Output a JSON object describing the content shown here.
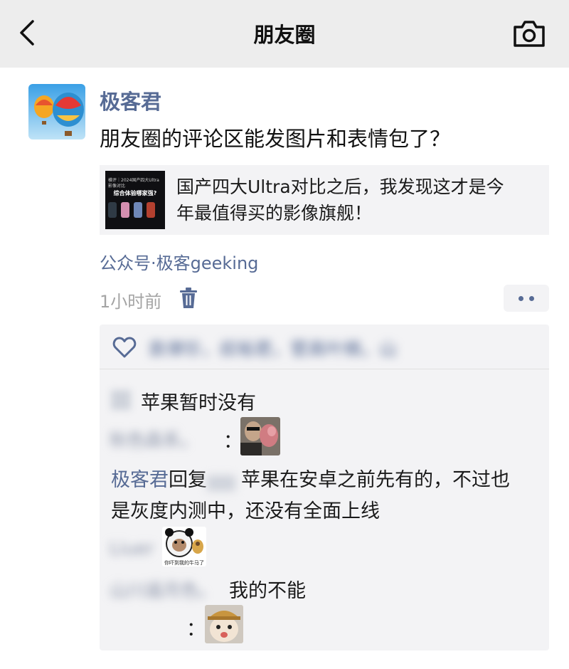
{
  "nav": {
    "title": "朋友圈",
    "back_icon": "chevron-left-icon",
    "camera_icon": "camera-icon"
  },
  "post": {
    "author": "极客君",
    "text": "朋友圈的评论区能发图片和表情包了？",
    "share": {
      "thumb_caption": "横评｜2024国产四大Ultra影像对比",
      "thumb_title": "综合体验哪家强?",
      "title_line1": "国产四大Ultra对比之后，我发现这才是今",
      "title_line2": "年最值得买的影像旗舰！"
    },
    "source": "公众号·极客geeking",
    "time": "1小时前",
    "delete_icon": "trash-icon",
    "more_icon": "more-dots-icon"
  },
  "likes": {
    "icon": "heart-icon",
    "names": "袁律珍，叔裕君，菅高叶楠，山"
  },
  "comments": [
    {
      "name": "",
      "text": "苹果暂时没有"
    },
    {
      "name": "秋色森系。",
      "sep": "：",
      "sticker": "sticker-meme-man"
    },
    {
      "name": "极客君",
      "reply_word": "回复",
      "reply_to": "",
      "text_line1": "苹果在安卓之前先有的，不过也",
      "text_line2": "是灰度内测中，还没有全面上线"
    },
    {
      "name": "Liuer",
      "sticker": "sticker-panda-meme",
      "sticker_caption": "你吓到我的牛马了"
    },
    {
      "name": "山川遥月色。",
      "text": "我的不能"
    },
    {
      "name": "",
      "sep": "：",
      "sticker": "sticker-cat-meme"
    }
  ],
  "colors": {
    "link": "#576b95",
    "nav_bg": "#ededed",
    "panel_bg": "#f3f3f5"
  }
}
